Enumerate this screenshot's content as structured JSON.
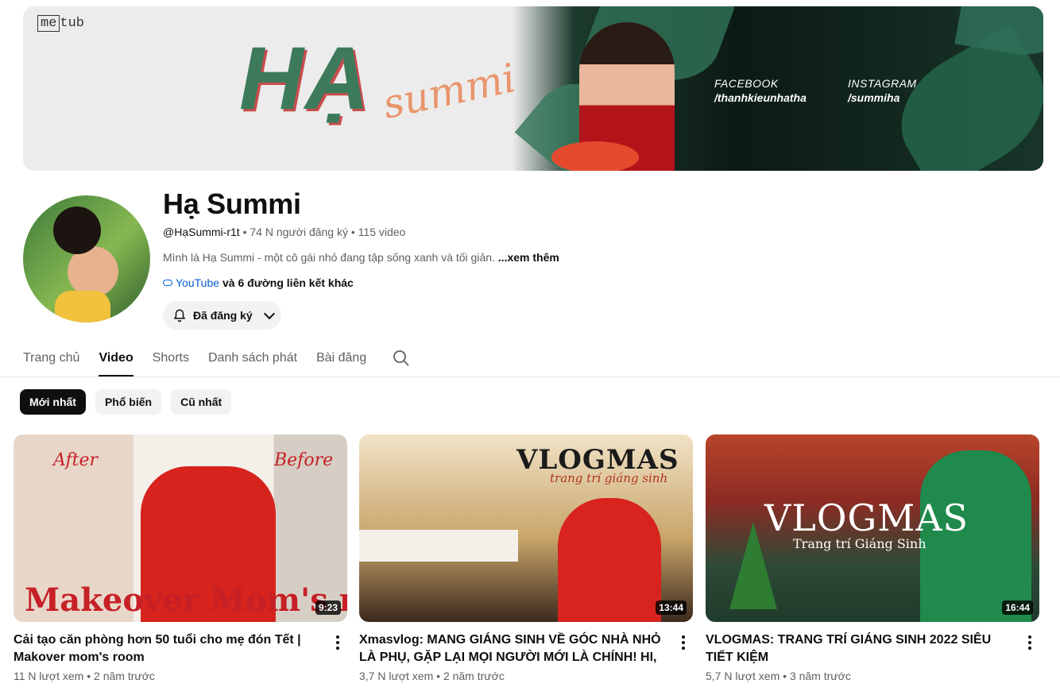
{
  "banner": {
    "logo_text": "me tub",
    "title": "HẠ",
    "script": "summi",
    "facebook_label": "FACEBOOK",
    "facebook_handle": "/thanhkieunhatha",
    "instagram_label": "INSTAGRAM",
    "instagram_handle": "/summiha"
  },
  "channel": {
    "name": "Hạ Summi",
    "handle": "@HạSummi-r1t",
    "subscribers": "74 N người đăng ký",
    "video_count": "115 video",
    "description": "Mình là Hạ Summi - một cô gái nhỏ đang tập sống xanh và tối giản.",
    "more_label": "...xem thêm",
    "link_label": "YouTube",
    "link_extra": "và 6 đường liên kết khác",
    "subscribe_label": "Đã đăng ký"
  },
  "tabs": [
    "Trang chủ",
    "Video",
    "Shorts",
    "Danh sách phát",
    "Bài đăng"
  ],
  "active_tab": "Video",
  "chips": [
    "Mới nhất",
    "Phổ biến",
    "Cũ nhất"
  ],
  "active_chip": "Mới nhất",
  "videos": [
    {
      "title": "Cải tạo căn phòng hơn 50 tuổi cho mẹ đón Tết | Makover mom's room",
      "views": "11 N lượt xem",
      "age": "2 năm trước",
      "duration": "9:23",
      "thumb_text": "Makeover Mom's room",
      "thumb_after": "After",
      "thumb_before": "Before"
    },
    {
      "title": "Xmasvlog: MANG GIÁNG SINH VỀ GÓC NHÀ NHỎ LÀ PHỤ, GẶP LẠI MỌI NGƯỜI MỚI LÀ CHÍNH! HI, I'M ...",
      "views": "3,7 N lượt xem",
      "age": "2 năm trước",
      "duration": "13:44",
      "thumb_text": "VLOGMAS",
      "thumb_sub": "trang trí giáng sinh"
    },
    {
      "title": "VLOGMAS: TRANG TRÍ GIÁNG SINH 2022 SIÊU TIẾT KIỆM",
      "views": "5,7 N lượt xem",
      "age": "3 năm trước",
      "duration": "16:44",
      "thumb_text": "VLOGMAS",
      "thumb_sub": "Trang trí Giáng Sinh"
    }
  ],
  "colors": {
    "link": "#065fd4",
    "text": "#0f0f0f",
    "secondary": "#606060",
    "chip_active": "#0f0f0f"
  }
}
